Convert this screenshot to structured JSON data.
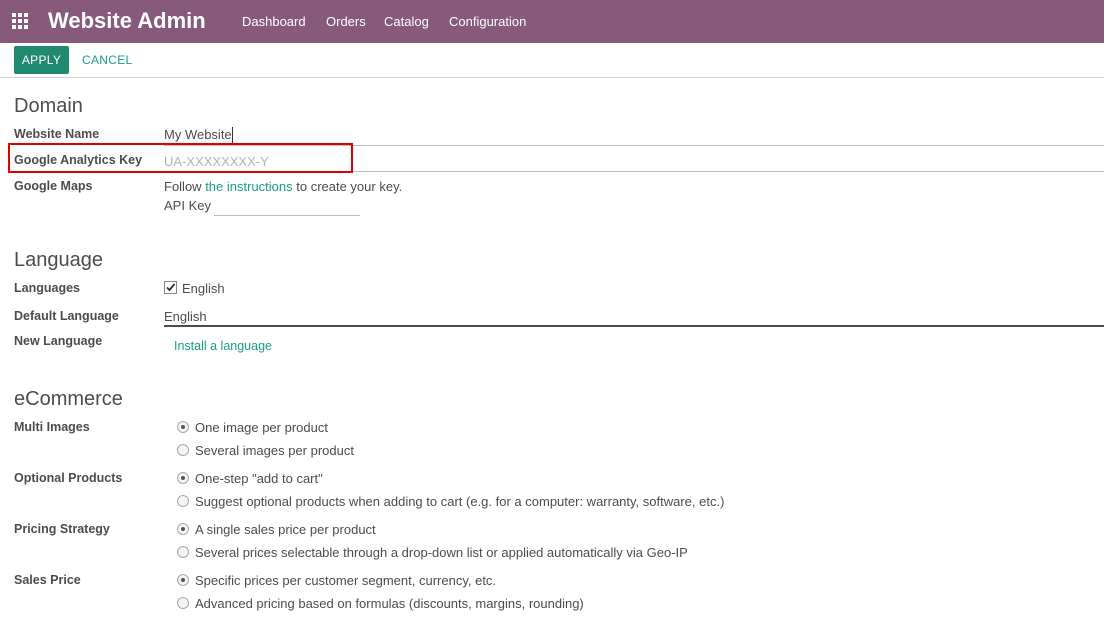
{
  "header": {
    "app_title": "Website Admin",
    "menu": [
      "Dashboard",
      "Orders",
      "Catalog",
      "Configuration"
    ]
  },
  "toolbar": {
    "apply_label": "APPLY",
    "cancel_label": "CANCEL"
  },
  "domain": {
    "title": "Domain",
    "website_name_label": "Website Name",
    "website_name_value": "My Website",
    "ga_label": "Google Analytics Key",
    "ga_placeholder": "UA-XXXXXXXX-Y",
    "maps_label": "Google Maps",
    "maps_text_before": "Follow ",
    "maps_link": "the instructions",
    "maps_text_after": " to create your key.",
    "api_key_label": "API Key"
  },
  "language": {
    "title": "Language",
    "languages_label": "Languages",
    "languages_value": "English",
    "default_label": "Default Language",
    "default_value": "English",
    "new_label": "New Language",
    "install_link": "Install a language"
  },
  "ecommerce": {
    "title": "eCommerce",
    "multi_images_label": "Multi Images",
    "multi_images_opt1": "One image per product",
    "multi_images_opt2": "Several images per product",
    "optional_label": "Optional Products",
    "optional_opt1": "One-step \"add to cart\"",
    "optional_opt2": "Suggest optional products when adding to cart (e.g. for a computer: warranty, software, etc.)",
    "pricing_label": "Pricing Strategy",
    "pricing_opt1": "A single sales price per product",
    "pricing_opt2": "Several prices selectable through a drop-down list or applied automatically via Geo-IP",
    "sales_label": "Sales Price",
    "sales_opt1": "Specific prices per customer segment, currency, etc.",
    "sales_opt2": "Advanced pricing based on formulas (discounts, margins, rounding)"
  },
  "colors": {
    "topbar": "#875a7b",
    "primary": "#1f8a6f",
    "link": "#1a9f86",
    "highlight": "#e00000"
  }
}
